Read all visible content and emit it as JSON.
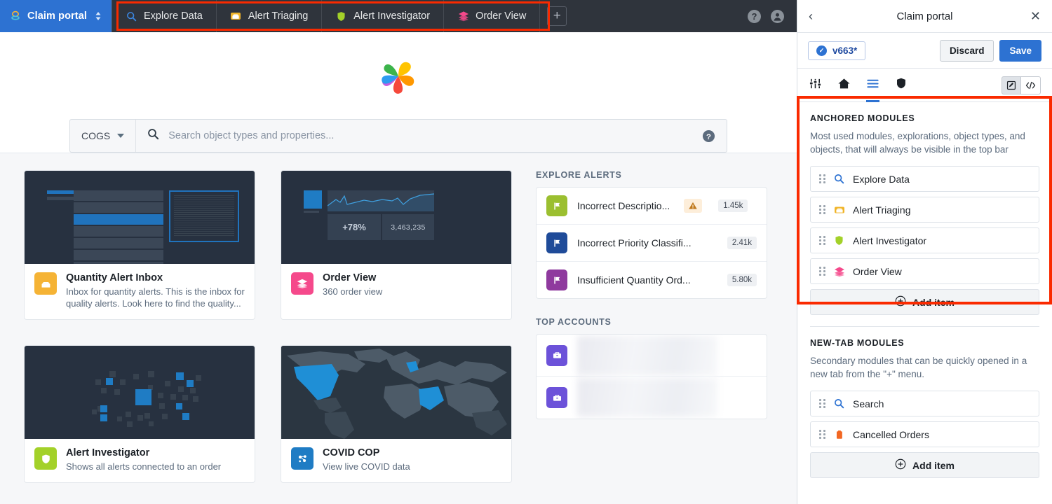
{
  "topnav": {
    "brand": {
      "label": "Claim portal",
      "icon": "app-logo-icon",
      "caret": "selector-caret-icon",
      "bg": "#2d72d2"
    },
    "tabs": [
      {
        "label": "Explore Data",
        "icon": "magnifier-icon",
        "color": "#2d72d2"
      },
      {
        "label": "Alert Triaging",
        "icon": "inbox-icon",
        "color": "#f0b429"
      },
      {
        "label": "Alert Investigator",
        "icon": "shield-icon",
        "color": "#a3d129"
      },
      {
        "label": "Order View",
        "icon": "layers-icon",
        "color": "#f5498b"
      }
    ],
    "add_tab": "+",
    "help_icon": "help-icon",
    "user_icon": "user-avatar-icon"
  },
  "hero": {
    "logo": "color-wheel-icon",
    "wheel_colors": [
      "#ffc400",
      "#ff9800",
      "#f5483b",
      "#c45ce0",
      "#2d9bf0",
      "#3cb44b"
    ]
  },
  "search": {
    "scope": "COGS",
    "placeholder": "Search object types and properties...",
    "search_icon": "search-icon",
    "help_icon": "help-icon",
    "caret_icon": "chevron-down-icon"
  },
  "cards": [
    {
      "title": "Quantity Alert Inbox",
      "desc": "Inbox for quantity alerts. This is the inbox for quality alerts. Look here to find the quality...",
      "icon": "inbox-icon",
      "icon_bg": "#f5b335",
      "thumb": "table-detail-thumb"
    },
    {
      "title": "Order View",
      "desc": "360 order view",
      "icon": "layers-icon",
      "icon_bg": "#f5498b",
      "thumb": "dashboard-thumb",
      "thumb_stats": {
        "delta": "+78%",
        "value": "3,463,235"
      }
    },
    {
      "title": "Alert Investigator",
      "desc": "Shows all alerts connected to an order",
      "icon": "shield-icon",
      "icon_bg": "#a3d129",
      "thumb": "graph-thumb"
    },
    {
      "title": "COVID COP",
      "desc": "View live COVID data",
      "icon": "cluster-icon",
      "icon_bg": "#1f7cc4",
      "thumb": "world-map-thumb"
    }
  ],
  "explore_alerts": {
    "title": "EXPLORE ALERTS",
    "rows": [
      {
        "label": "Incorrect Descriptio...",
        "count": "1.45k",
        "icon": "flag-icon",
        "icon_bg": "#9bbf30",
        "warning": true,
        "warning_icon": "warning-triangle-icon"
      },
      {
        "label": "Incorrect Priority Classifi...",
        "count": "2.41k",
        "icon": "flag-icon",
        "icon_bg": "#1f4b99",
        "warning": false
      },
      {
        "label": "Insufficient Quantity Ord...",
        "count": "5.80k",
        "icon": "flag-icon",
        "icon_bg": "#8f3a9e",
        "warning": false
      }
    ]
  },
  "top_accounts": {
    "title": "TOP ACCOUNTS",
    "rows": [
      {
        "icon": "briefcase-icon",
        "icon_bg": "#6c52d9",
        "redacted": true
      },
      {
        "icon": "briefcase-icon",
        "icon_bg": "#6c52d9",
        "redacted": true
      }
    ]
  },
  "panel": {
    "back_icon": "chevron-left-icon",
    "title": "Claim portal",
    "close_icon": "close-icon",
    "version": {
      "label": "v663*",
      "check_icon": "check-circle-icon"
    },
    "discard_label": "Discard",
    "save_label": "Save",
    "tabs": [
      {
        "icon": "sliders-icon",
        "active": false
      },
      {
        "icon": "home-icon",
        "active": false
      },
      {
        "icon": "list-icon",
        "active": true
      },
      {
        "icon": "shield-icon",
        "active": false
      }
    ],
    "tools": [
      {
        "icon": "edit-pencil-icon",
        "active": true
      },
      {
        "icon": "code-icon",
        "active": false
      }
    ],
    "groups": [
      {
        "title": "ANCHORED MODULES",
        "desc": "Most used modules, explorations, object types, and objects, that will always be visible in the top bar",
        "items": [
          {
            "label": "Explore Data",
            "icon": "magnifier-icon",
            "color": "#2d72d2"
          },
          {
            "label": "Alert Triaging",
            "icon": "inbox-icon",
            "color": "#f0b429"
          },
          {
            "label": "Alert Investigator",
            "icon": "shield-icon",
            "color": "#a3d129"
          },
          {
            "label": "Order View",
            "icon": "layers-icon",
            "color": "#f5498b"
          }
        ],
        "add_label": "Add item",
        "add_icon": "plus-circle-icon",
        "highlighted": true
      },
      {
        "title": "NEW-TAB MODULES",
        "desc": "Secondary modules that can be quickly opened in a new tab from the \"+\" menu.",
        "items": [
          {
            "label": "Search",
            "icon": "magnifier-icon",
            "color": "#2d72d2"
          },
          {
            "label": "Cancelled Orders",
            "icon": "clipboard-icon",
            "color": "#f26722"
          }
        ],
        "add_label": "Add item",
        "add_icon": "plus-circle-icon",
        "highlighted": false
      }
    ]
  },
  "highlight_color": "#fa2a00"
}
